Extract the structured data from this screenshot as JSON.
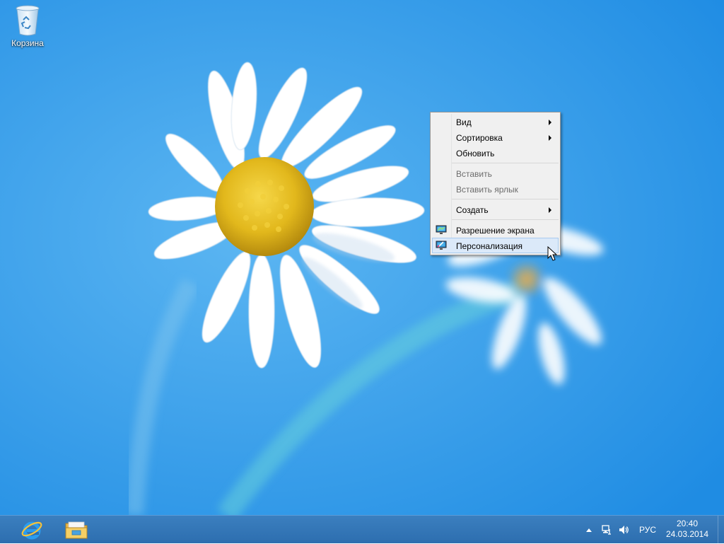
{
  "desktop": {
    "icons": [
      {
        "label": "Корзина",
        "icon": "recycle-bin-icon"
      }
    ]
  },
  "context_menu": {
    "items": [
      {
        "label": "Вид",
        "submenu": true,
        "disabled": false
      },
      {
        "label": "Сортировка",
        "submenu": true,
        "disabled": false
      },
      {
        "label": "Обновить",
        "submenu": false,
        "disabled": false
      },
      {
        "label": "Вставить",
        "submenu": false,
        "disabled": true
      },
      {
        "label": "Вставить ярлык",
        "submenu": false,
        "disabled": true
      },
      {
        "label": "Создать",
        "submenu": true,
        "disabled": false
      },
      {
        "label": "Разрешение экрана",
        "submenu": false,
        "disabled": false,
        "icon": "screen-resolution-icon"
      },
      {
        "label": "Персонализация",
        "submenu": false,
        "disabled": false,
        "icon": "personalization-icon",
        "highlighted": true
      }
    ]
  },
  "taskbar": {
    "pinned": [
      {
        "icon": "internet-explorer-icon"
      },
      {
        "icon": "file-explorer-icon"
      }
    ],
    "tray": {
      "language": "РУС",
      "time": "20:40",
      "date": "24.03.2014",
      "icons": [
        "show-hidden-icons-icon",
        "network-icon",
        "volume-icon"
      ]
    }
  },
  "colors": {
    "desktop_blue": "#2b9bec",
    "taskbar": "#2d6eaf",
    "menu_bg": "#f0f0f0",
    "menu_highlight": "#dbe9f9"
  }
}
